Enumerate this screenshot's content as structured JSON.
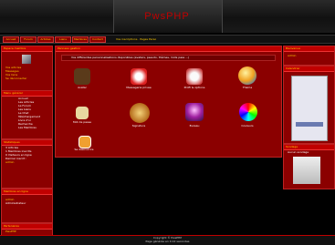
{
  "header": {
    "logo": "PwsPHP"
  },
  "nav": {
    "buttons": [
      "Accueil",
      "Forum",
      "Articles",
      "Liens",
      "Membres",
      "Contact"
    ],
    "link": "Vos inscriptions · Pages Perso"
  },
  "left": {
    "member": {
      "title": "Espace membre",
      "items": [
        "Vos articles",
        "Messages",
        "Vos liens",
        "Se déconnecter"
      ]
    },
    "menu": {
      "title": "Menu général",
      "items": [
        "Accueil",
        "Les Articles",
        "Le Forum",
        "Les Liens",
        "Le Chat",
        "Téléchargement",
        "Livre d'or",
        "Recherche",
        "Les Membres"
      ]
    },
    "stats": {
      "title": "Statistiques",
      "items": [
        "3 Articles",
        "1 Membres inscrits",
        "0 Visiteurs en ligne",
        "Dernier inscrit :",
        "admin"
      ]
    },
    "online": {
      "title": "Membres en ligne",
      "items": [
        "admin",
        "Administrateur"
      ]
    },
    "box": {
      "title": "Partenaires",
      "items": [
        "PwsPHP"
      ]
    }
  },
  "center": {
    "title": "Panneau gestion",
    "intro": "Vos différentes personnalisations disponibles (avatars, pseudo, thèmes, mots pass ...)",
    "icons": [
      {
        "name": "avatar-icon",
        "label": "Avatar"
      },
      {
        "name": "messages-icon",
        "label": "Messagerie privée"
      },
      {
        "name": "profile-icon",
        "label": "Profil & options"
      },
      {
        "name": "theme-icon",
        "label": "Thème"
      },
      {
        "name": "password-icon",
        "label": "Mot de passe"
      },
      {
        "name": "signature-icon",
        "label": "Signature"
      },
      {
        "name": "desktop-icon",
        "label": "Bureau"
      },
      {
        "name": "colors-icon",
        "label": "Couleurs"
      },
      {
        "name": "delete-icon",
        "label": "Se désinscrire"
      }
    ]
  },
  "right": {
    "welcome": {
      "title": "Bienvenue",
      "user": "admin"
    },
    "calendar": {
      "title": "Calendrier"
    },
    "poll": {
      "title": "Sondage",
      "text": "Aucun sondage"
    }
  },
  "footer": {
    "line1": "Copyright © PwsPHP",
    "line2": "Page générée en 0.12 secondes"
  }
}
